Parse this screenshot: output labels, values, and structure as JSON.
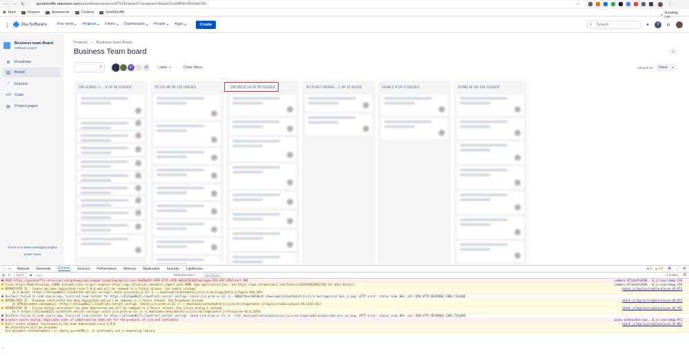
{
  "browser": {
    "url_host": "goodshuffle.atlassian.net",
    "url_path": "/jira/software/projects/KTD/boards/5?assignee=5bab911a08ff0878b1b8b766",
    "bookmarks": [
      "Apps",
      "Finance",
      "Apartments",
      "Cooking",
      "GoodShuffle"
    ],
    "reading_list": "Reading List"
  },
  "nav": {
    "product": "Jira Software",
    "items": [
      {
        "label": "Your work"
      },
      {
        "label": "Projects"
      },
      {
        "label": "Filters"
      },
      {
        "label": "Dashboards"
      },
      {
        "label": "People"
      },
      {
        "label": "Apps"
      }
    ],
    "create": "Create",
    "search_placeholder": "Search"
  },
  "sidebar": {
    "project_name": "Business team Board",
    "project_type": "Software project",
    "items": [
      {
        "label": "Roadmap",
        "icon": "roadmap-icon"
      },
      {
        "label": "Board",
        "icon": "board-icon"
      },
      {
        "label": "Reports",
        "icon": "reports-icon"
      },
      {
        "label": "Code",
        "icon": "code-icon"
      },
      {
        "label": "Project pages",
        "icon": "pages-icon"
      }
    ],
    "footer_text": "You're in a team-managed project",
    "learn_more": "Learn more"
  },
  "board": {
    "breadcrumb": [
      "Projects",
      "Business team Board"
    ],
    "title": "Business Team board",
    "avatar_extra": "+5",
    "avatar_p": "P",
    "label_filter": "Label",
    "clear_filters": "Clear filters",
    "group_by_label": "GROUP BY",
    "group_by_value": "None",
    "columns": [
      {
        "title": "ON-GOING / L...  8 OF 68 ISSUES"
      },
      {
        "title": "TO DO 48 OF 191 ISSUES"
      },
      {
        "title": "ON DECK 14 OF 89 ISSUES"
      },
      {
        "title": "ACTIVELY BEING...  1 OF 13 ISSUE"
      },
      {
        "title": "GOALS 4 OF 8 ISSUES"
      },
      {
        "title": "DONE 46 OF 156 ISSUES"
      }
    ]
  },
  "devtools": {
    "tabs": [
      "Elements",
      "Console",
      "Sources",
      "Network",
      "Performance",
      "Memory",
      "Application",
      "Security",
      "Lighthouse"
    ],
    "context": "top",
    "filter_placeholder": "Filter",
    "levels": "Default levels",
    "issues": "No Issues",
    "hidden": "5 hidden",
    "error_count": "2",
    "warn_count": "10",
    "logs": [
      {
        "type": "err",
        "text": "POST https://goodshuffle.atlassian.net/gateway/api/engage-targeting/api/v2/user/6a030455-9199-473f-a520-bd0142919d2/messages/STG-EXT-459/start 409",
        "src": "commons.073cbdfa3930...0.js:sourcemap:236"
      },
      {
        "type": "warn",
        "text": "Cross-Origin Read Blocking (CORB) blocked cross-origin response https://api.atlassian.com/metal/ingest with MIME type application/json. See https://www.chromestatus.com/feature/5629709824032768 for more details.",
        "src": "commons.073cbdfa3930...0.js:sourcemap:259"
      },
      {
        "type": "warn",
        "text": "DEPRECATED JS - Cookie has been deprecated since 5.8.0 and will be removed in a future release. Use cookie instead.\n    at b.derail (https://dl13uwd0127.cloudfront.net/atl-vertigo--shard-jira-prod-us-23--3--/_download/contextbatch/js/jira.heritage/batch.js?agile:946:209)",
        "src": "batch.js?agile=true&locale=en-US:972"
      },
      {
        "type": "info",
        "text": "DevTools failed to load source map: Could not load content for https://dl13uwd0127.cloudfront.net/atl-vertigo--shard-jira-prod-us-23--3--.880b5f0ae190590c4/_download/contextbatch/js/jira.heritage/init-min.js.map: HTTP error: status code 404, net::ERR_HTTP_RESPONSE_CODE_FAILURE",
        "src": ""
      },
      {
        "type": "warn",
        "text": "DEPRECATED JS - Dropdown constructor has been deprecated and will be removed in a future release. Use Dropdown2 instead.\n    at HTMLDocument.<anonymous> (https://dl13uwd0127.cloudfront.net/atl-vertigo--shard-jira-prod-us-23--3--/_download/contextbatch/js/jira.heritage/batch.js?agile=true&locale=en-US:5154:101)",
        "src": "batch.js?agile=true&locale=en-US:972"
      },
      {
        "type": "warn",
        "text": "DEPRECATED JS - Inline dialog constructor has been deprecated and will be removed in a future release. Use inline dialog 2 instead.\n    at t (https://dl13uwd0127.cloudfront.net/atl-vertigo--shard-jira-prod-us-23--3--/_download/contextbatch/js/jira.heritage/batch.js?locale=en-US:6:2054)",
        "src": "batch.js?agile=true&locale=en-US:972"
      },
      {
        "type": "info",
        "text": "DevTools failed to load source map: Could not load content for https://dl13uwd0127.cloudfront.net/atl-vertigo--shard-jira-prod-us-23--3--.fc8/_download/contextbatch/css/jira.heritage/add3-breadcrumbs-min.css.map: HTTP error: status code 404, net::ERR_HTTP_RESPONSE_CODE_FAILURE",
        "src": ""
      },
      {
        "type": "err",
        "text": "product-search-dialog: Duplicate order of undefined has been set for the products of jira and confluence",
        "src": "async-extensible-sea...0.js:sourcemap:972"
      },
      {
        "type": "warn",
        "text": "AJS's create element functionality has been deprecated since 5.9.0.\nNo alternative will be provided.\nUse document.createElement() or jQuery.parseHTML(), or preferably use a templating library.",
        "src": "batch.js?agile=true&locale=en-US:963"
      }
    ]
  },
  "colors": {
    "brand": "#0052cc",
    "highlight_border": "#d9342b"
  }
}
